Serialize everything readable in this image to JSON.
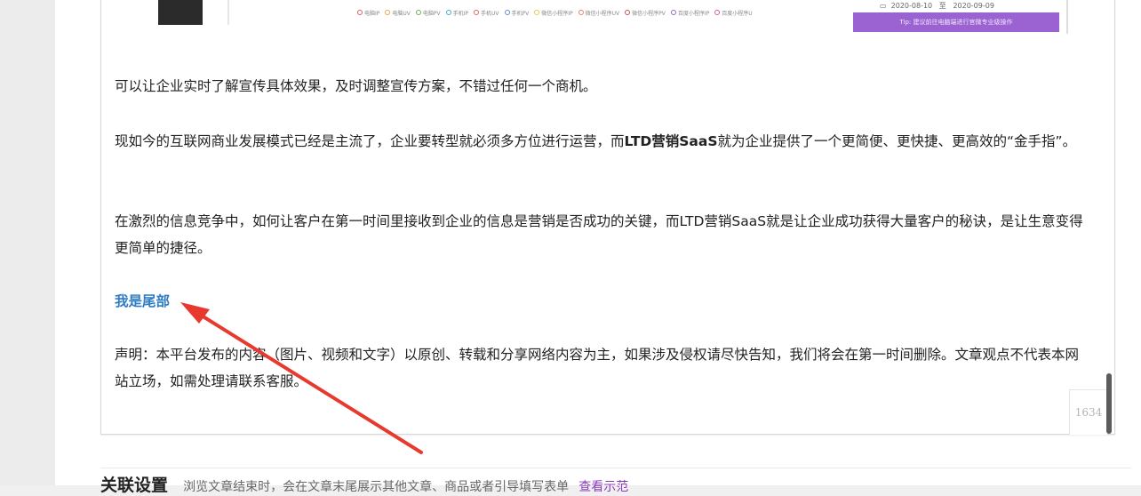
{
  "embed": {
    "legend": [
      {
        "label": "电脑IP",
        "color": "#e25b5b"
      },
      {
        "label": "电脑UV",
        "color": "#f0a24a"
      },
      {
        "label": "电脑PV",
        "color": "#68b34a"
      },
      {
        "label": "手机IP",
        "color": "#4aa3d8"
      },
      {
        "label": "手机UV",
        "color": "#e06b5b"
      },
      {
        "label": "手机PV",
        "color": "#5b8fd8"
      },
      {
        "label": "微信小程序IP",
        "color": "#f2c84a"
      },
      {
        "label": "微信小程序UV",
        "color": "#e38a5a"
      },
      {
        "label": "微信小程序PV",
        "color": "#c85050"
      },
      {
        "label": "百度小程序IP",
        "color": "#9a63d1"
      },
      {
        "label": "百度小程序U",
        "color": "#d060a0"
      }
    ],
    "date_from": "2020-08-10",
    "date_sep": "至",
    "date_to": "2020-09-09",
    "tip": "Tip: 建议前往电脑端进行官微专业级操作"
  },
  "article": {
    "p1": "可以让企业实时了解宣传具体效果，及时调整宣传方案，不错过任何一个商机。",
    "p2_before": "现如今的互联网商业发展模式已经是主流了，企业要转型就必须多方位进行运营，而",
    "p2_bold": "LTD营销SaaS",
    "p2_after": "就为企业提供了一个更简便、更快捷、更高效的“金手指”。",
    "p3": "在激烈的信息竞争中，如何让客户在第一时间里接收到企业的信息是营销是否成功的关键，而LTD营销SaaS就是让企业成功获得大量客户的秘诀，是让生意变得更简单的捷径。",
    "p4": "我是尾部",
    "p5": "声明：本平台发布的内容（图片、视频和文字）以原创、转载和分享网络内容为主，如果涉及侵权请尽快告知，我们将会在第一时间删除。文章观点不代表本网站立场，如需处理请联系客服。"
  },
  "counter": "1634",
  "footer": {
    "title": "关联设置",
    "desc": "浏览文章结束时，会在文章末尾展示其他文章、商品或者引导填写表单",
    "link": "查看示范"
  },
  "colors": {
    "accent_blue": "#2f7cc4",
    "arrow_red": "#e8392f",
    "tip_purple": "#9a63d1"
  }
}
